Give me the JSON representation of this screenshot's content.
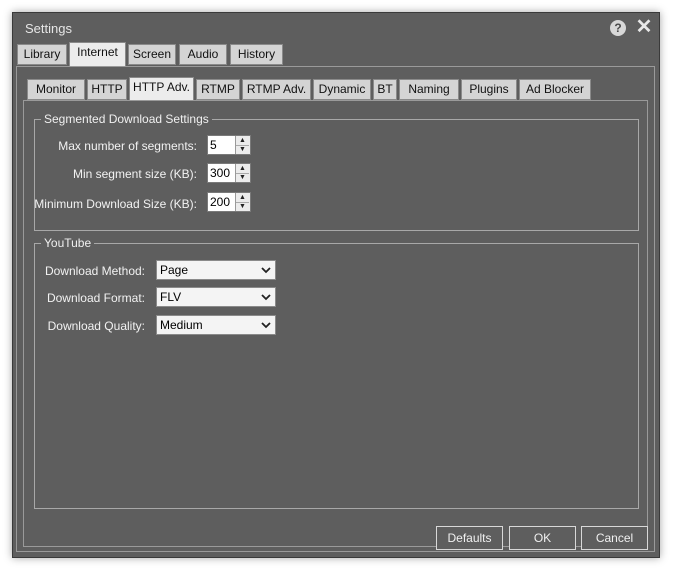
{
  "window": {
    "title": "Settings"
  },
  "top_tabs": [
    "Library",
    "Internet",
    "Screen",
    "Audio",
    "History"
  ],
  "sub_tabs": [
    "Monitor",
    "HTTP",
    "HTTP Adv.",
    "RTMP",
    "RTMP Adv.",
    "Dynamic",
    "BT",
    "Naming",
    "Plugins",
    "Ad Blocker"
  ],
  "active_top_tab": "Internet",
  "active_sub_tab": "HTTP Adv.",
  "segmented": {
    "legend": "Segmented Download Settings",
    "max_segments_label": "Max number of segments:",
    "max_segments_value": "5",
    "min_segment_size_label": "Min segment size (KB):",
    "min_segment_size_value": "300",
    "min_download_size_label": "Minimum Download Size (KB):",
    "min_download_size_value": "200"
  },
  "youtube": {
    "legend": "YouTube",
    "method_label": "Download Method:",
    "method_value": "Page",
    "format_label": "Download Format:",
    "format_value": "FLV",
    "quality_label": "Download Quality:",
    "quality_value": "Medium"
  },
  "buttons": {
    "defaults": "Defaults",
    "ok": "OK",
    "cancel": "Cancel"
  },
  "colors": {
    "window_bg": "#5e5e5e",
    "tab_bg": "#d4d4d4",
    "active_tab_bg": "#ececec"
  }
}
